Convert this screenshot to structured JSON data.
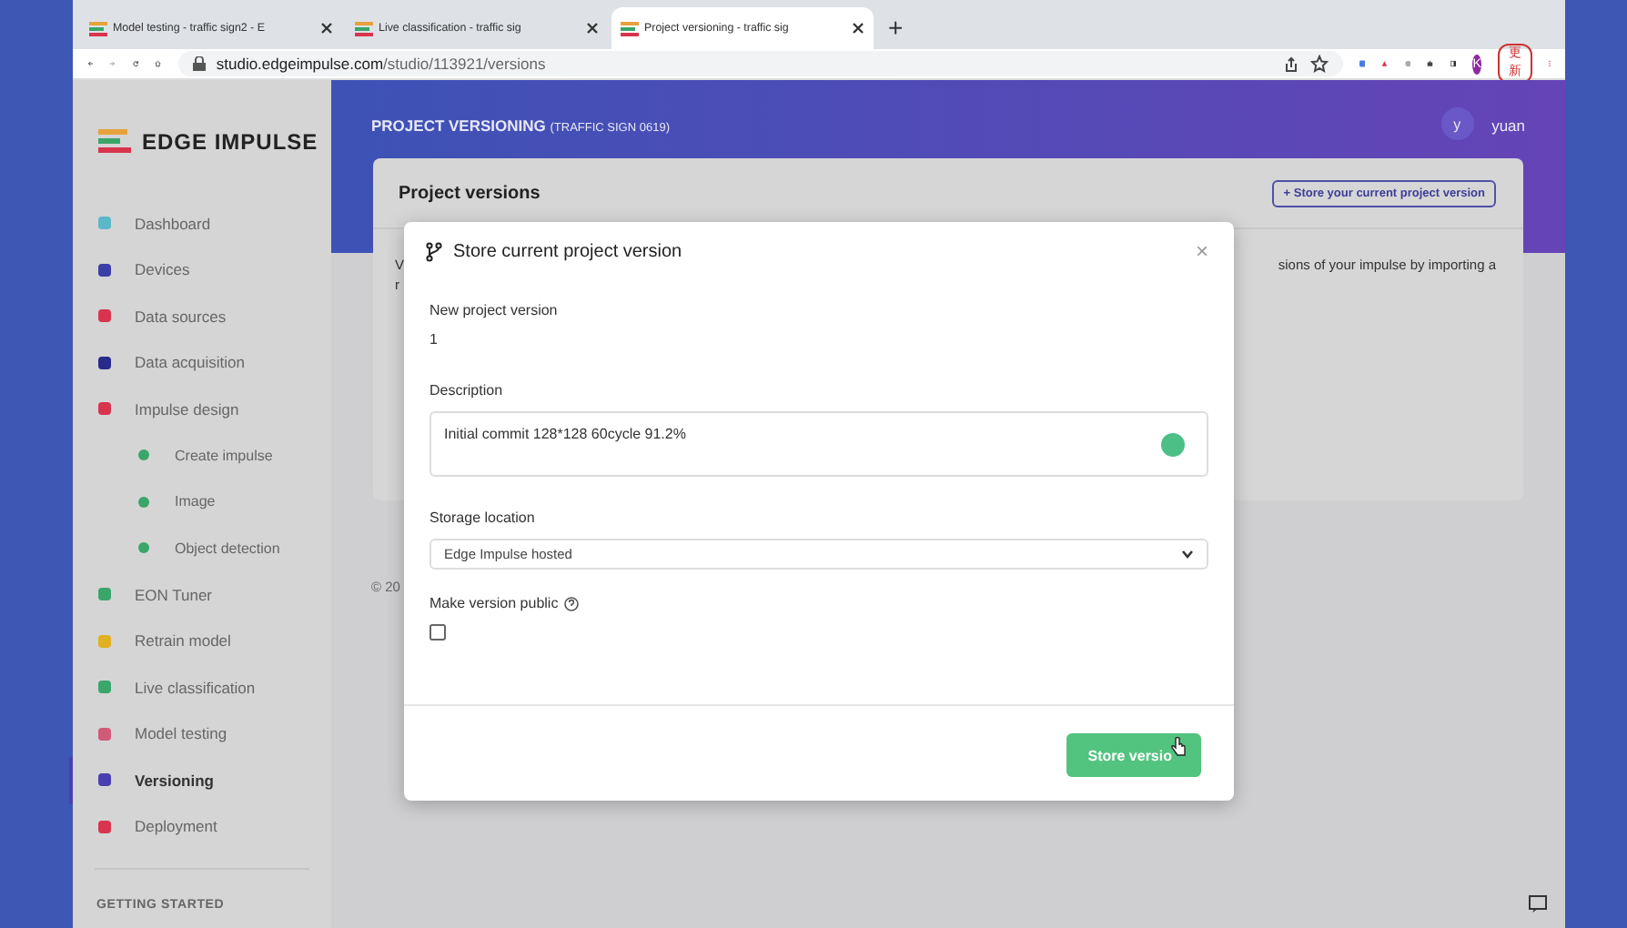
{
  "browser": {
    "tabs": [
      {
        "label": "Model testing - traffic sign2 - E",
        "selected": false
      },
      {
        "label": "Live classification - traffic sig",
        "selected": false
      },
      {
        "label": "Project versioning - traffic sig",
        "selected": true
      }
    ],
    "new_tab": "+",
    "url_host": "studio.edgeimpulse.com",
    "url_path": "/studio/113921/versions",
    "profile": "K",
    "update_button": "更新"
  },
  "sidebar": {
    "logo": "EDGE IMPULSE",
    "items": [
      {
        "kind": "item",
        "label": "Dashboard",
        "color": "#5bb8c9",
        "selected": false
      },
      {
        "kind": "item",
        "label": "Devices",
        "color": "#3c3fa8",
        "selected": false
      },
      {
        "kind": "item",
        "label": "Data sources",
        "color": "#d8344e",
        "selected": false
      },
      {
        "kind": "item",
        "label": "Data acquisition",
        "color": "#2a2a8c",
        "selected": false
      },
      {
        "kind": "item",
        "label": "Impulse design",
        "color": "#d8344e",
        "selected": false
      },
      {
        "kind": "sub",
        "label": "Create impulse",
        "color": "#3aa66a",
        "selected": false
      },
      {
        "kind": "sub",
        "label": "Image",
        "color": "#3aa66a",
        "selected": false
      },
      {
        "kind": "sub",
        "label": "Object detection",
        "color": "#3aa66a",
        "selected": false
      },
      {
        "kind": "item",
        "label": "EON Tuner",
        "color": "#3aa66a",
        "selected": false
      },
      {
        "kind": "item",
        "label": "Retrain model",
        "color": "#e0b020",
        "selected": false
      },
      {
        "kind": "item",
        "label": "Live classification",
        "color": "#3aa66a",
        "selected": false
      },
      {
        "kind": "item",
        "label": "Model testing",
        "color": "#d05a78",
        "selected": false
      },
      {
        "kind": "item",
        "label": "Versioning",
        "color": "#4a3fb0",
        "selected": true
      },
      {
        "kind": "item",
        "label": "Deployment",
        "color": "#d8344e",
        "selected": false
      }
    ],
    "section": "GETTING STARTED"
  },
  "header": {
    "title": "PROJECT VERSIONING",
    "project": "(TRAFFIC SIGN 0619)",
    "avatar": "y",
    "user": "yuan"
  },
  "card": {
    "title": "Project versions",
    "button": "+ Store your current project version",
    "text_left_1": "V",
    "text_left_2": "r",
    "text_right": "sions of your impulse by importing a"
  },
  "footer": "© 20",
  "modal": {
    "title": "Store current project version",
    "close": "×",
    "version_label": "New project version",
    "version": "1",
    "description_label": "Description",
    "description": "Initial commit 128*128 60cycle 91.2%",
    "storage_label": "Storage location",
    "storage": "Edge Impulse hosted",
    "public_label": "Make version public",
    "public": false,
    "submit": "Store versio"
  }
}
